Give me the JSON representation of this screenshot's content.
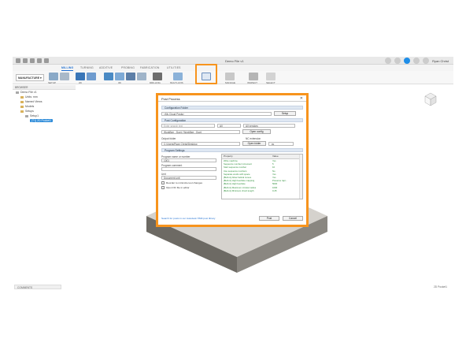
{
  "app": {
    "document_title": "Demo File v1",
    "user_name": "Ryan Christ",
    "workspace": "MANUFACTURE"
  },
  "tabs": [
    "MILLING",
    "TURNING",
    "ADDITIVE",
    "PROBING",
    "FABRICATION",
    "UTILITIES"
  ],
  "ribbon": {
    "groups": [
      "SETUP",
      "2D",
      "3D",
      "DRILLING",
      "MULTI-AXIS",
      "MANAGE",
      "INSPECT",
      "SELECT"
    ]
  },
  "browser": {
    "header": "BROWSER",
    "items": [
      {
        "label": "Demo File v1",
        "level": 0
      },
      {
        "label": "Units: mm",
        "level": 1
      },
      {
        "label": "Named Views",
        "level": 1
      },
      {
        "label": "Models",
        "level": 1
      },
      {
        "label": "Setups",
        "level": 1
      },
      {
        "label": "Setup1",
        "level": 2
      },
      {
        "label": "[T1] 2D Pocket1",
        "level": 3,
        "selected": true
      }
    ]
  },
  "bottombar": {
    "comments": "COMMENTS",
    "status": "2D Pocket1"
  },
  "dialog": {
    "title": "Post Process",
    "config_folder_label": "Configuration Folder",
    "config_folder_value": "<My Cloud Posts>",
    "setup_button": "Setup",
    "post_config_label": "Post Configuration",
    "search_placeholder": "Enter search text",
    "filter_all": "All",
    "filter_vendors": "All vendors",
    "post_value": "WorkBee - Duet / WorkBee - Duet",
    "open_config_button": "Open config",
    "output_folder_label": "Output folder",
    "output_folder_value": "C:/Users/Ryan Christ/Desktop",
    "open_folder_button": "Open folder",
    "nc_extension_label": "NC extension",
    "nc_extension_value": ".nc",
    "program_settings_label": "Program Settings",
    "program_name_label": "Program name or number",
    "program_name_value": "1001",
    "program_comment_label": "Program comment",
    "program_comment_value": "",
    "unit_label": "Unit",
    "unit_value": "Document unit",
    "reorder_label": "Reorder to minimize tool changes",
    "open_nc_label": "Open NC file in editor",
    "search_link": "Search for posts in our Autodesk HSM post library",
    "post_button": "Post",
    "cancel_button": "Cancel",
    "table_header": {
      "property": "Property",
      "value": "Value"
    },
    "properties": [
      {
        "name": "Write machine",
        "value": "Yes"
      },
      {
        "name": "Sequence number increment",
        "value": "5"
      },
      {
        "name": "Start sequence number",
        "value": "10"
      },
      {
        "name": "Use sequence numbers",
        "value": "No"
      },
      {
        "name": "Separate words with space",
        "value": "Yes"
      },
      {
        "name": "[Built-in] Allow helical moves",
        "value": "Yes"
      },
      {
        "name": "[Built-in] High feedrate mapping",
        "value": "Preserve rapi..."
      },
      {
        "name": "[Built-in] High feedrate",
        "value": "5000"
      },
      {
        "name": "[Built-in] Maximum circular radius",
        "value": "1000"
      },
      {
        "name": "[Built-in] Minimum chord length",
        "value": "0.25"
      }
    ]
  }
}
